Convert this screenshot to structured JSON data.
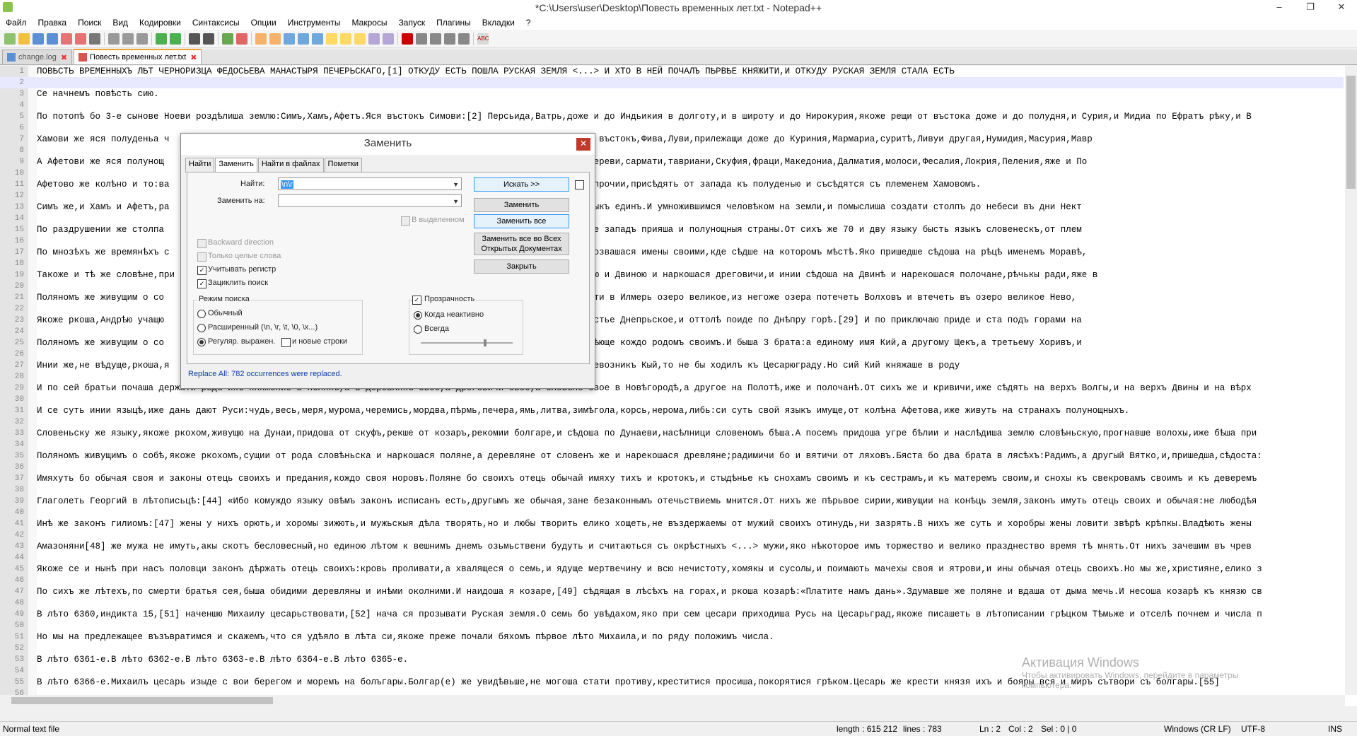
{
  "window": {
    "title": "*C:\\Users\\user\\Desktop\\Повесть временных лет.txt - Notepad++",
    "controls": [
      "–",
      "❐",
      "✕"
    ]
  },
  "menu": [
    "Файл",
    "Правка",
    "Поиск",
    "Вид",
    "Кодировки",
    "Синтаксисы",
    "Опции",
    "Инструменты",
    "Макросы",
    "Запуск",
    "Плагины",
    "Вкладки",
    "?"
  ],
  "tabs": [
    {
      "label": "change.log",
      "active": false
    },
    {
      "label": "Повесть временных лет.txt",
      "active": true
    }
  ],
  "editor": {
    "current_line": 2,
    "lines": [
      {
        "n": "1",
        "t": "ПОВѢСТЬ ВРЕМЕННЫХЪ ЛѢТ ЧЕРНОРИЗЦА ФЕДОСЬЕВА МАНАСТЫРЯ ПЕЧЕРЬСКАГО,[1] ОТКУДУ ЕСТЬ ПОШЛА РУСКАЯ ЗЕМЛЯ <...> И ХТО В НЕЙ ПОЧАЛЪ ПѢРВѢЕ КНЯЖИТИ,И ОТКУДУ РУСКАЯ ЗЕМЛЯ СТАЛА ЕСТЬ"
      },
      {
        "n": "2",
        "t": ""
      },
      {
        "n": "3",
        "t": "Се начнемъ повѣсть сию."
      },
      {
        "n": "4",
        "t": ""
      },
      {
        "n": "5",
        "t": "По потопѣ бо 3-е сынове Ноеви роздѣлиша землю:Симъ,Хамъ,Афетъ.Яся въстокъ Симови:[2] Персьида,Ватрь,доже и до Индьикия в долготу,и в широту и до Нирокурия,якоже рещи от въстока доже и до полудня,и Сурия,и Мидиа по Ефратъ рѣку,и В"
      },
      {
        "n": "6",
        "t": ""
      },
      {
        "n": "7",
        "t": "Хамови же яся полуденьа ч                                          ить рѣка ефиопьскаа Чермьна,текущия на въстокъ,Фива,Луви,прилежащи доже до Куриния,Мармариа,суритѣ,Ливуи другая,Нумидия,Масурия,Мавр"
      },
      {
        "n": "8",
        "t": ""
      },
      {
        "n": "9",
        "t": "А Афетови же яся полунощ                                          агони,Галатия,Кольхысъ,Воспорий,меоти,дереви,сармати,тавриани,Скуфия,фраци,Македониа,Далматия,молоси,Фесалия,Локрия,Пеления,яже и По"
      },
      {
        "n": "10",
        "t": ""
      },
      {
        "n": "11",
        "t": "Афетово же колѣно и то:ва                                          нѣмци,корлязи,[16] венедици,фрягове и прочии,присѣдять от запада къ полуденью и съсѣдятся съ племенем Хамовомъ."
      },
      {
        "n": "12",
        "t": ""
      },
      {
        "n": "13",
        "t": "Симъ же,и Хамъ и Афетъ,ра                                          живяху кождо въ своей части.И бысть языкъ единъ.И умножившимся человѣком на земли,и помыслиша создати столпъ до небеси въ дни Нект"
      },
      {
        "n": "14",
        "t": ""
      },
      {
        "n": "15",
        "t": "По раздрушении же столпа                                          нове полуденныя страны.Афетови же сынове западъ прияша и полунощныя страны.От сихъ же 70 и дву языку бысть языкъ словенескъ,от плем"
      },
      {
        "n": "16",
        "t": ""
      },
      {
        "n": "17",
        "t": "По мнозѣхъ же времянѣхъ с                                          тѣхъ словенъ разидошася по земьли и прозвашася имены своими,кде сѣдше на которомъ мѣстѣ.Яко пришедше сѣдоша на рѣцѣ именемъ Моравѣ,"
      },
      {
        "n": "18",
        "t": ""
      },
      {
        "n": "19",
        "t": "Такоже и тѣ же словѣне,при                                          в лѣсѣхъ,а друзии сѣдоша межи Припѣтью и Двиною и наркошася дреговичи,и инии сѣдоша на Двинѣ и нарекошася полочане,рѣчькы ради,яже в"
      },
      {
        "n": "20",
        "t": ""
      },
      {
        "n": "21",
        "t": "Поляномъ же живущим о со                                          Днѣпра волокъ до Ловоти,и по Ловоти внити в Илмерь озеро великое,из негоже озера потечеть Волховъ и втечеть въ озеро великое Нево,"
      },
      {
        "n": "22",
        "t": ""
      },
      {
        "n": "23",
        "t": "Якоже ркоша,Андрѣю учащю                                          ске,и въсхотѣ поити в Римъ,и приде въ устье Днепрьское,и оттолѣ поиде по Днѣпру горѣ.[29] И по приключаю приде и ста подъ горами на"
      },
      {
        "n": "24",
        "t": ""
      },
      {
        "n": "25",
        "t": "Поляномъ же живущим о со                                          съ родом своимъ на своихъ мѣстехъ,володѣюще кождо родомъ своимъ.И быша 3 брата:а единому имя Кий,а другому Щекъ,а третьему Хоривъ,и"
      },
      {
        "n": "26",
        "t": ""
      },
      {
        "n": "27",
        "t": "Инии же,не вѣдуще,ркоша,я                                          «На перевозъ на Киевъ».Аще бо былъ перевозникъ Кый,то не бы ходилъ къ Цесарюграду.Но сий Кий княжаше в роду"
      },
      {
        "n": "28",
        "t": ""
      },
      {
        "n": "29",
        "t": "И по сей братьи почаша держати родъ ихъ княжение в поляхъ,а в деревляхъ свое,а дреговичи свое,а словѣне свое в Новѣгородѣ,а другое на Полотѣ,иже и полочанѣ.От сихъ же и кривичи,иже сѣдять на верхъ Волгы,и на верхъ Двины и на вѣрх"
      },
      {
        "n": "30",
        "t": ""
      },
      {
        "n": "31",
        "t": "И се суть инии языцѣ,иже дань дают Руси:чудь,весь,меря,мурома,черемись,мордва,пѣрмь,печера,ямь,литва,зимѣгола,корсь,нерома,либь:си суть свой языкъ имуще,от колѣна Афетова,иже живуть на странахъ полунощныхъ."
      },
      {
        "n": "32",
        "t": ""
      },
      {
        "n": "33",
        "t": "Словеньску же языку,якоже ркохом,живущю на Дунаи,придоша от скуфъ,рекше от козаръ,рекомии болгаре,и сѣдоша по Дунаеви,насѣлници словеномъ бѣша.А посемъ придоша угре бѣлии и наслѣдиша землю словѣньскую,прогнавше волохы,иже бѣша при"
      },
      {
        "n": "34",
        "t": ""
      },
      {
        "n": "35",
        "t": "Поляномъ живущимъ о собѣ,якоже ркохомъ,сущии от рода словѣньска и наркошася поляне,а деревляне от словенъ же и нарекошася древляне;радимичи бо и вятичи от ляховъ.Бяста бо два брата в лясѣхъ:Радимъ,а другый Вятко,и,пришедша,сѣдоста:"
      },
      {
        "n": "36",
        "t": ""
      },
      {
        "n": "37",
        "t": "Имяхуть бо обычая своя и законы отець своихъ и предания,кождо своя норовъ.Поляне бо своихъ отець обычай имяху тихъ и кротокъ,и стыдѣнье къ снохамъ своимъ и къ сестрамъ,и къ матеремъ своим,и снохы къ свекровамъ своимъ и къ деверемъ"
      },
      {
        "n": "38",
        "t": ""
      },
      {
        "n": "39",
        "t": "Глаголеть Георгий в лѣтописьцѣ:[44] «Ибо комуждо языку овѣмъ законъ исписанъ есть,другымъ же обычая,зане безаконнымъ отечьствиемь мнится.От нихъ же пѣрьвое сирии,живущии на конѣць земля,законъ имуть отець своих и обычая:не любодѣя"
      },
      {
        "n": "40",
        "t": ""
      },
      {
        "n": "41",
        "t": "Инѣ же законъ гилиомъ:[47] жены у нихъ орють,и хоромы зижють,и мужьскыя дѣла творять,но и любы творить елико хощеть,не въздержаемы от мужий своихъ отинудь,ни зазрять.В нихъ же суть и хоробры жены ловити звѣрѣ крѣпкы.Владѣють жены"
      },
      {
        "n": "42",
        "t": ""
      },
      {
        "n": "43",
        "t": "Амазоняни[48] же мужа не имуть,акы скотъ бесловесный,но единою лѣтом к вешнимъ днемъ озьмьствени будуть и считаються съ окрѣстныхъ <...> мужи,яко нѣкоторое имъ торжество и велико празднество время тѣ мнять.От нихъ зачешим въ чрев"
      },
      {
        "n": "44",
        "t": ""
      },
      {
        "n": "45",
        "t": "Якоже се и нынѣ при насъ половци законъ дѣржать отець своихъ:кровь проливати,а хвалящеся о семь,и ядуще мертвечину и всю нечистоту,хомякы и сусолы,и поимають мачехы своя и ятрови,и ины обычая отець своихъ.Но мы же,християне,елико з"
      },
      {
        "n": "46",
        "t": ""
      },
      {
        "n": "47",
        "t": "По сихъ же лѣтехъ,по смерти братья сея,быша обидими деревляны и инѣми околними.И наидоша я козаре,[49] сѣдящая в лѣсѣхъ на горах,и ркоша козарѣ:«Платите намъ дань».Здумавше же поляне и вдаша от дыма мечь.И несоша козарѣ къ князю св"
      },
      {
        "n": "48",
        "t": ""
      },
      {
        "n": "49",
        "t": "В лѣто 6360,индикта 15,[51] наченшю Михаилу цесарьствовати,[52] нача ся прозывати Руская земля.О семь бо увѣдахом,яко при сем цесари приходиша Русь на Цесарьград,якоже писашеть в лѣтописании грѣцком Тѣмьже и отселѣ почнем и числа п"
      },
      {
        "n": "50",
        "t": ""
      },
      {
        "n": "51",
        "t": "Но мы на предлежащее възъвратимся и скажемъ,что ся удѣяло в лѣта си,якоже преже почали бяхомъ пѣрвое лѣто Михаила,и по ряду положимъ числа."
      },
      {
        "n": "52",
        "t": ""
      },
      {
        "n": "53",
        "t": "В лѣто 6361-е.В лѣто 6362-е.В лѣто 6363-е.В лѣто 6364-е.В лѣто 6365-е."
      },
      {
        "n": "54",
        "t": ""
      },
      {
        "n": "55",
        "t": "В лѣто 6366-е.Михаилъ цесарь изыде с вои берегом и моремъ на болъгары.Болгар(е) же увидѣвьше,не могоша стати противу,креститися просиша,покорятися грѣком.Цесарь же крести князя ихъ и бояры вся и миръ сътвори съ болгары.[55]"
      },
      {
        "n": "56",
        "t": ""
      }
    ]
  },
  "dialog": {
    "title": "Заменить",
    "tabs": [
      "Найти",
      "Заменить",
      "Найти в файлах",
      "Пометки"
    ],
    "active_tab": "Заменить",
    "find_label": "Найти:",
    "find_value": "\\n\\r",
    "replace_label": "Заменить на:",
    "replace_value": "",
    "in_selection_label": "В выделенном",
    "buttons": {
      "find_next": "Искать >>",
      "replace": "Заменить",
      "replace_all": "Заменить все",
      "replace_all_open_1": "Заменить все во Всех",
      "replace_all_open_2": "Открытых Документах",
      "close": "Закрыть"
    },
    "options": {
      "backward": "Backward direction",
      "whole_word": "Только целые слова",
      "match_case": "Учитывать регистр",
      "wrap": "Зациклить поиск"
    },
    "search_mode": {
      "title": "Режим поиска",
      "normal": "Обычный",
      "extended": "Расширенный (\\n, \\r, \\t, \\0, \\x...)",
      "regex": "Регуляр. выражен.",
      "newline": "и новые строки",
      "selected": "regex"
    },
    "transparency": {
      "title": "Прозрачность",
      "inactive": "Когда неактивно",
      "always": "Всегда",
      "level": 0.7
    },
    "status": "Replace All: 782 occurrences were replaced."
  },
  "statusbar": {
    "type": "Normal text file",
    "length": "length : 615 212",
    "lines": "lines : 783",
    "ln": "Ln : 2",
    "col": "Col : 2",
    "sel": "Sel : 0 | 0",
    "eol": "Windows (CR LF)",
    "encoding": "UTF-8",
    "mode": "INS"
  },
  "watermark": {
    "line1": "Активация Windows",
    "line2": "Чтобы активировать Windows, перейдите в параметры",
    "line3": "компьютера."
  }
}
